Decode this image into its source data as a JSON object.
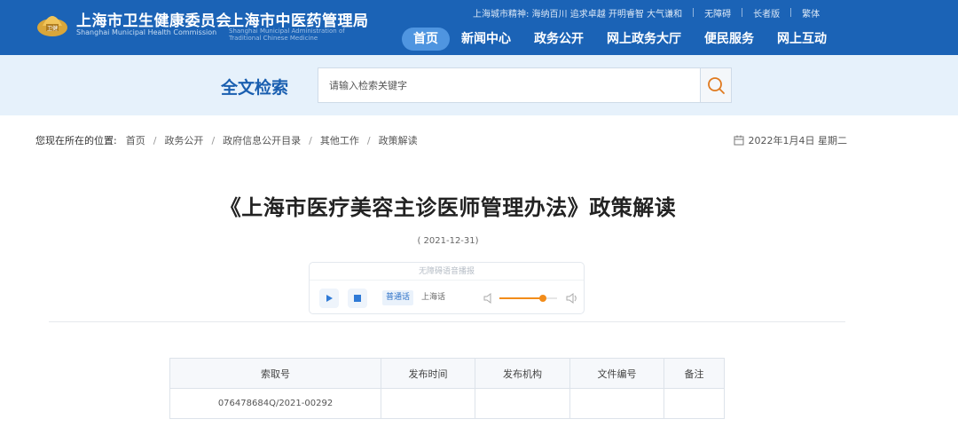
{
  "header": {
    "org1": "上海市卫生健康委员会",
    "org1_en": "Shanghai Municipal Health Commission",
    "org2": "上海市中医药管理局",
    "org2_en": "Shanghai Municipal Administration of Traditional Chinese Medicine",
    "spirit": "上海城市精神: 海纳百川 追求卓越 开明睿智 大气谦和",
    "links": [
      "无障碍",
      "长者版",
      "繁体"
    ],
    "nav": [
      "首页",
      "新闻中心",
      "政务公开",
      "网上政务大厅",
      "便民服务",
      "网上互动"
    ],
    "active_nav": "首页"
  },
  "search": {
    "title": "全文检索",
    "placeholder": "请输入检索关键字",
    "icon": "search-icon"
  },
  "breadcrumb": {
    "lead": "您现在所在的位置:",
    "items": [
      "首页",
      "政务公开",
      "政府信息公开目录",
      "其他工作",
      "政策解读"
    ]
  },
  "date": "2022年1月4日 星期二",
  "article": {
    "title": "《上海市医疗美容主诊医师管理办法》政策解读",
    "pubdate": "( 2021-12-31)"
  },
  "player": {
    "header": "无障碍语音播报",
    "langs": [
      "普通话",
      "上海话"
    ],
    "active_lang": "普通话",
    "volume": 0.75
  },
  "info_table": {
    "headers": [
      "索取号",
      "发布时间",
      "发布机构",
      "文件编号",
      "备注"
    ],
    "rows": [
      [
        "07647868​4Q/2021-00292",
        "",
        "",
        "",
        ""
      ]
    ]
  },
  "colors": {
    "header_bg": "#1b63b6",
    "nav_active": "#4f95e0",
    "search_band": "#e6f1fb",
    "accent": "#f28c1a"
  }
}
